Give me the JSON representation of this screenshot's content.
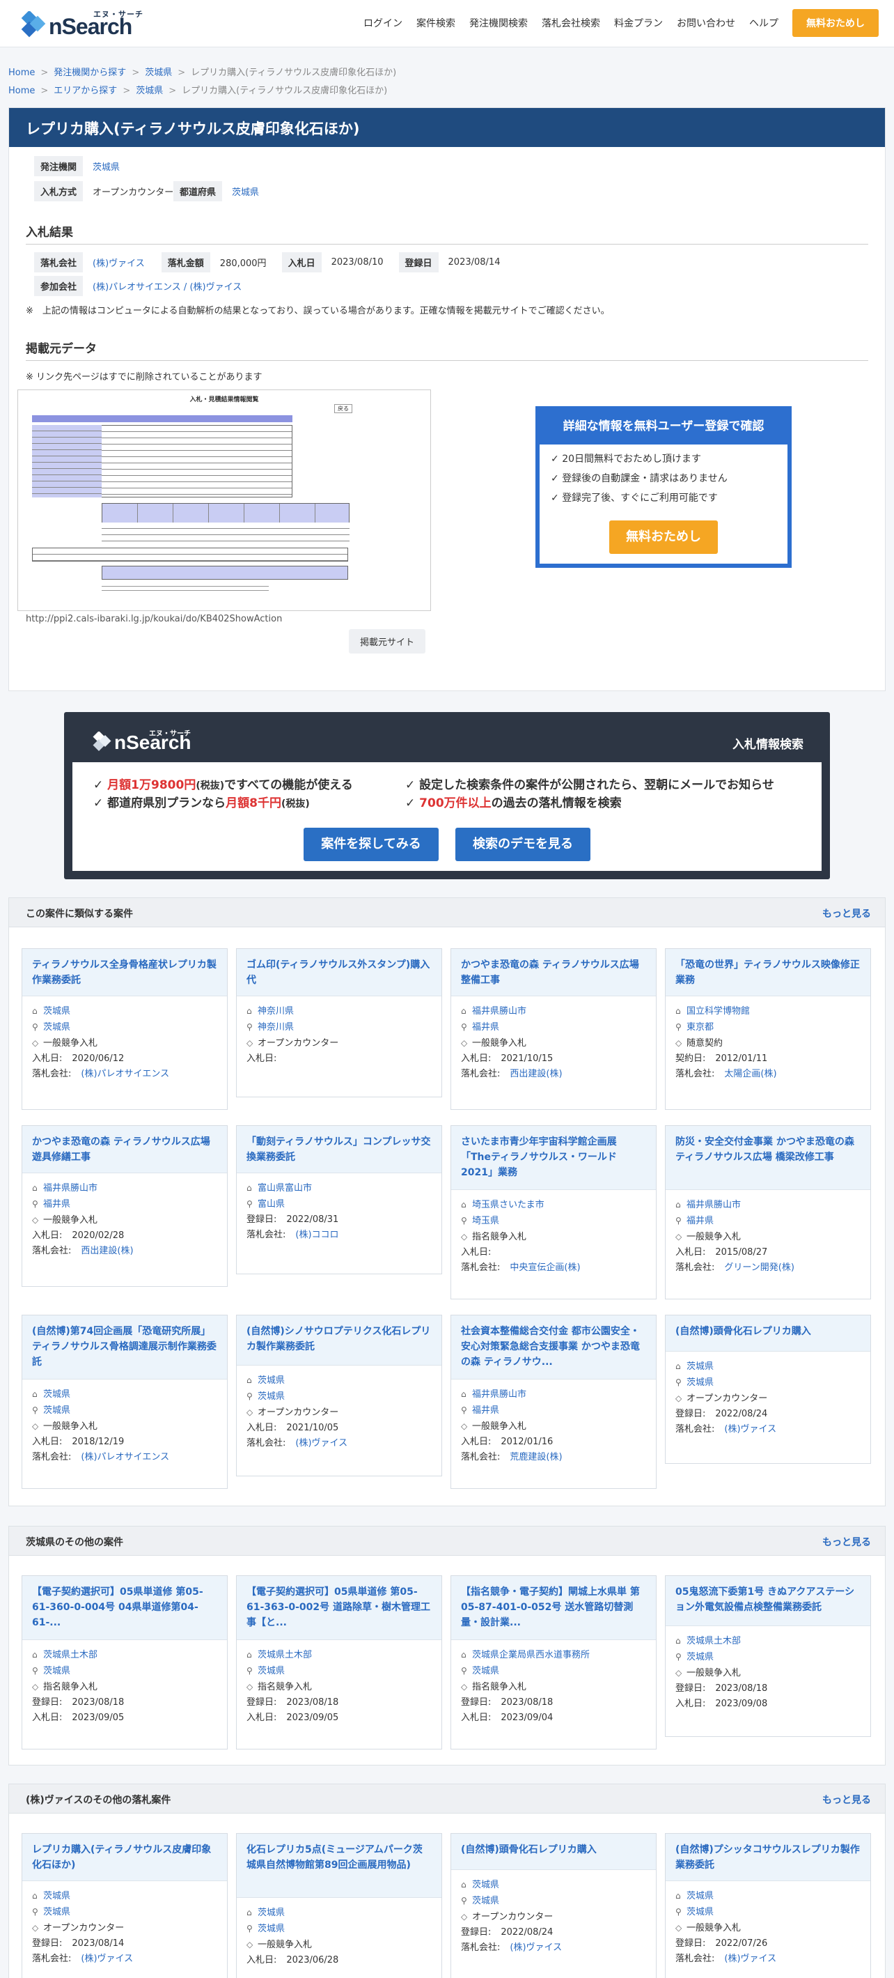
{
  "header": {
    "logo_kana": "エヌ・サーチ",
    "logo_text": "nSearch",
    "nav": [
      "ログイン",
      "案件検索",
      "発注機関検索",
      "落札会社検索",
      "料金プラン",
      "お問い合わせ",
      "ヘルプ"
    ],
    "cta": "無料おためし"
  },
  "breadcrumbs": [
    [
      "Home",
      "発注機関から探す",
      "茨城県",
      "レプリカ購入(ティラノサウルス皮膚印象化石ほか)"
    ],
    [
      "Home",
      "エリアから探す",
      "茨城県",
      "レプリカ購入(ティラノサウルス皮膚印象化石ほか)"
    ]
  ],
  "title": "レプリカ購入(ティラノサウルス皮膚印象化石ほか)",
  "info": {
    "agency_label": "発注機関",
    "agency": "茨城県",
    "method_label": "入札方式",
    "method": "オープンカウンター",
    "pref_label": "都道府県",
    "pref": "茨城県"
  },
  "result": {
    "heading": "入札結果",
    "winner_label": "落札会社",
    "winner": "(株)ヴァイス",
    "amount_label": "落札金額",
    "amount": "280,000円",
    "bid_date_label": "入札日",
    "bid_date": "2023/08/10",
    "reg_date_label": "登録日",
    "reg_date": "2023/08/14",
    "participants_label": "参加会社",
    "participants": [
      "(株)パレオサイエンス",
      "(株)ヴァイス"
    ],
    "participants_sep": " / ",
    "disclaimer": "※　上記の情報はコンピュータによる自動解析の結果となっており、誤っている場合があります。正確な情報を掲載元サイトでご確認ください。"
  },
  "source": {
    "heading": "掲載元データ",
    "note": "※ リンク先ページはすでに削除されていることがあります",
    "thumb_title": "入札・見積結果情報閲覧",
    "thumb_btn": "戻る",
    "url": "http://ppi2.cals-ibaraki.lg.jp/koukai/do/KB402ShowAction",
    "btn": "掲載元サイト"
  },
  "register": {
    "heading": "詳細な情報を無料ユーザー登録で確認",
    "items": [
      "20日間無料でおためし頂けます",
      "登録後の自動課金・請求はありません",
      "登録完了後、すぐにご利用可能です"
    ],
    "btn": "無料おためし"
  },
  "promo": {
    "logo_kana": "エヌ・サーチ",
    "logo_text": "nSearch",
    "tag": "入札情報検索",
    "l1a": "月額1万9800円",
    "l1b": "(税抜)",
    "l1c": "ですべての機能が使える",
    "l2a": "都道府県別プランなら",
    "l2b": "月額8千円",
    "l2c": "(税抜)",
    "r1": "設定した検索条件の案件が公開されたら、翌朝にメールでお知らせ",
    "r2a": "700万件以上",
    "r2b": "の過去の落札情報を検索",
    "btn1": "案件を探してみる",
    "btn2": "検索のデモを見る"
  },
  "similar": {
    "heading": "この案件に類似する案件",
    "more": "もっと見る",
    "cards": [
      {
        "title": "ティラノサウルス全身骨格産状レプリカ製作業務委託",
        "pref": "茨城県",
        "agency": "茨城県",
        "method": "一般競争入札",
        "rows": [
          [
            "入札日:",
            "2020/06/12",
            false
          ],
          [
            "落札会社:",
            "(株)パレオサイエンス",
            true
          ]
        ]
      },
      {
        "title": "ゴム印(ティラノサウルス外スタンプ)購入代",
        "pref": "神奈川県",
        "agency": "神奈川県",
        "method": "オープンカウンター",
        "rows": [
          [
            "入札日:",
            "",
            false
          ]
        ]
      },
      {
        "title": "かつやま恐竜の森 ティラノサウルス広場整備工事",
        "pref": "福井県勝山市",
        "agency": "福井県",
        "method": "一般競争入札",
        "rows": [
          [
            "入札日:",
            "2021/10/15",
            false
          ],
          [
            "落札会社:",
            "西出建設(株)",
            true
          ]
        ]
      },
      {
        "title": "「恐竜の世界」ティラノサウルス映像修正業務",
        "pref": "国立科学博物館",
        "agency": "東京都",
        "method": "随意契約",
        "rows": [
          [
            "契約日:",
            "2012/01/11",
            false
          ],
          [
            "落札会社:",
            "太陽企画(株)",
            true
          ]
        ]
      },
      {
        "title": "かつやま恐竜の森 ティラノサウルス広場遊具修繕工事",
        "pref": "福井県勝山市",
        "agency": "福井県",
        "method": "一般競争入札",
        "rows": [
          [
            "入札日:",
            "2020/02/28",
            false
          ],
          [
            "落札会社:",
            "西出建設(株)",
            true
          ]
        ]
      },
      {
        "title": "「動刻ティラノサウルス」コンプレッサ交換業務委託",
        "pref": "富山県富山市",
        "agency": "富山県",
        "method": "",
        "rows": [
          [
            "登録日:",
            "2022/08/31",
            false
          ],
          [
            "落札会社:",
            "(株)ココロ",
            true
          ]
        ]
      },
      {
        "title": "さいたま市青少年宇宙科学館企画展「Theティラノサウルス・ワールド2021」業務",
        "pref": "埼玉県さいたま市",
        "agency": "埼玉県",
        "method": "指名競争入札",
        "rows": [
          [
            "入札日:",
            "",
            false
          ],
          [
            "落札会社:",
            "中央宣伝企画(株)",
            true
          ]
        ]
      },
      {
        "title": "防災・安全交付金事業 かつやま恐竜の森 ティラノサウルス広場 橋梁改修工事",
        "pref": "福井県勝山市",
        "agency": "福井県",
        "method": "一般競争入札",
        "rows": [
          [
            "入札日:",
            "2015/08/27",
            false
          ],
          [
            "落札会社:",
            "グリーン開発(株)",
            true
          ]
        ]
      },
      {
        "title": "(自然博)第74回企画展「恐竜研究所展」ティラノサウルス骨格調達展示制作業務委託",
        "pref": "茨城県",
        "agency": "茨城県",
        "method": "一般競争入札",
        "rows": [
          [
            "入札日:",
            "2018/12/19",
            false
          ],
          [
            "落札会社:",
            "(株)パレオサイエンス",
            true
          ]
        ]
      },
      {
        "title": "(自然博)シノサウロプテリクス化石レプリカ製作業務委託",
        "pref": "茨城県",
        "agency": "茨城県",
        "method": "オープンカウンター",
        "rows": [
          [
            "入札日:",
            "2021/10/05",
            false
          ],
          [
            "落札会社:",
            "(株)ヴァイス",
            true
          ]
        ]
      },
      {
        "title": "社会資本整備総合交付金 都市公園安全・安心対策緊急総合支援事業 かつやま恐竜の森 ティラノサウ...",
        "pref": "福井県勝山市",
        "agency": "福井県",
        "method": "一般競争入札",
        "rows": [
          [
            "入札日:",
            "2012/01/16",
            false
          ],
          [
            "落札会社:",
            "荒鹿建設(株)",
            true
          ]
        ]
      },
      {
        "title": "(自然博)頭骨化石レプリカ購入",
        "pref": "茨城県",
        "agency": "茨城県",
        "method": "オープンカウンター",
        "rows": [
          [
            "登録日:",
            "2022/08/24",
            false
          ],
          [
            "落札会社:",
            "(株)ヴァイス",
            true
          ]
        ]
      }
    ]
  },
  "pref_other": {
    "heading": "茨城県のその他の案件",
    "more": "もっと見る",
    "cards": [
      {
        "title": "【電子契約選択可】05県単道修 第05-61-360-0-004号 04県単道修第04-61-...",
        "pref": "茨城県土木部",
        "agency": "茨城県",
        "method": "指名競争入札",
        "rows": [
          [
            "登録日:",
            "2023/08/18",
            false
          ],
          [
            "入札日:",
            "2023/09/05",
            false
          ]
        ]
      },
      {
        "title": "【電子契約選択可】05県単道修 第05-61-363-0-002号 道路除草・樹木管理工事【と...",
        "pref": "茨城県土木部",
        "agency": "茨城県",
        "method": "指名競争入札",
        "rows": [
          [
            "登録日:",
            "2023/08/18",
            false
          ],
          [
            "入札日:",
            "2023/09/05",
            false
          ]
        ]
      },
      {
        "title": "【指名競争・電子契約】閘城上水県単 第05-87-401-0-052号 送水管路切替測量・設計業...",
        "pref": "茨城県企業局県西水道事務所",
        "agency": "茨城県",
        "method": "指名競争入札",
        "rows": [
          [
            "登録日:",
            "2023/08/18",
            false
          ],
          [
            "入札日:",
            "2023/09/04",
            false
          ]
        ]
      },
      {
        "title": "05鬼怒流下委第1号 きぬアクアステーション外電気設備点検整備業務委託",
        "pref": "茨城県土木部",
        "agency": "茨城県",
        "method": "一般競争入札",
        "rows": [
          [
            "登録日:",
            "2023/08/18",
            false
          ],
          [
            "入札日:",
            "2023/09/08",
            false
          ]
        ]
      }
    ]
  },
  "company_other": {
    "heading": "(株)ヴァイスのその他の落札案件",
    "more": "もっと見る",
    "cards": [
      {
        "title": "レプリカ購入(ティラノサウルス皮膚印象化石ほか)",
        "pref": "茨城県",
        "agency": "茨城県",
        "method": "オープンカウンター",
        "rows": [
          [
            "登録日:",
            "2023/08/14",
            false
          ],
          [
            "落札会社:",
            "(株)ヴァイス",
            true
          ]
        ]
      },
      {
        "title": "化石レプリカ5点(ミュージアムパーク茨城県自然博物館第89回企画展用物品)",
        "pref": "茨城県",
        "agency": "茨城県",
        "method": "一般競争入札",
        "rows": [
          [
            "入札日:",
            "2023/06/28",
            false
          ]
        ]
      },
      {
        "title": "(自然博)頭骨化石レプリカ購入",
        "pref": "茨城県",
        "agency": "茨城県",
        "method": "オープンカウンター",
        "rows": [
          [
            "登録日:",
            "2022/08/24",
            false
          ],
          [
            "落札会社:",
            "(株)ヴァイス",
            true
          ]
        ]
      },
      {
        "title": "(自然博)プシッタコサウルスレプリカ製作業務委託",
        "pref": "茨城県",
        "agency": "茨城県",
        "method": "一般競争入札",
        "rows": [
          [
            "登録日:",
            "2022/07/26",
            false
          ],
          [
            "落札会社:",
            "(株)ヴァイス",
            true
          ]
        ]
      }
    ]
  }
}
